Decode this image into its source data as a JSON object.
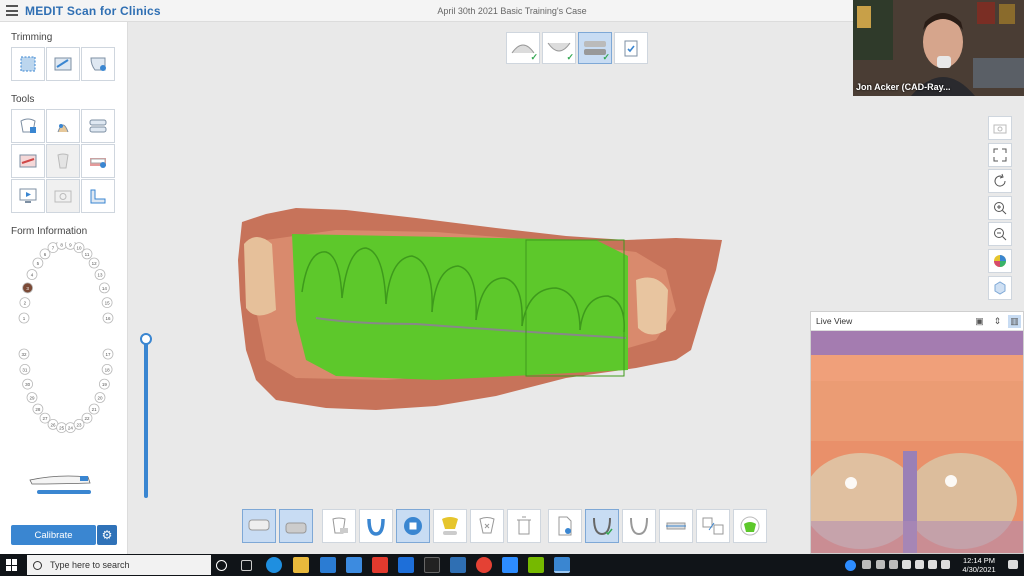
{
  "app": {
    "brand": "MEDIT Scan for Clinics",
    "document_title": "April 30th 2021 Basic Training's Case"
  },
  "left_panel": {
    "trimming_title": "Trimming",
    "tools_title": "Tools",
    "form_title": "Form Information",
    "calibrate_label": "Calibrate"
  },
  "tooth_numbers_upper": [
    "1",
    "2",
    "3",
    "4",
    "5",
    "6",
    "7",
    "8",
    "9",
    "10",
    "11",
    "12",
    "13",
    "14",
    "15",
    "16"
  ],
  "tooth_numbers_lower": [
    "17",
    "18",
    "19",
    "20",
    "21",
    "22",
    "23",
    "24",
    "25",
    "26",
    "27",
    "28",
    "29",
    "30",
    "31",
    "32"
  ],
  "webcam": {
    "participant_name": "Jon Acker (CAD-Ray..."
  },
  "live_view": {
    "title": "Live View"
  },
  "taskbar": {
    "search_placeholder": "Type here to search",
    "time": "12:14 PM",
    "date": "4/30/2021"
  },
  "colors": {
    "accent": "#3a86d1",
    "scan_highlight": "#5dc82b",
    "active_button": "#c8dcf3"
  }
}
